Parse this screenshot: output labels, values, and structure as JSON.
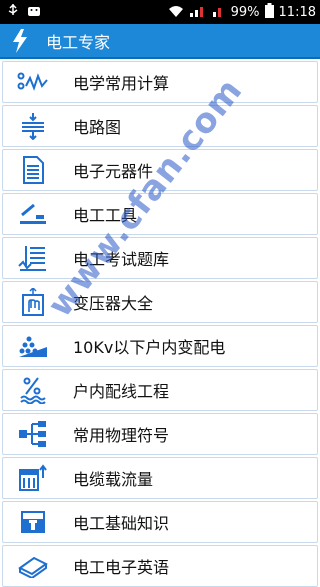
{
  "status": {
    "battery": "99%",
    "time": "11:18"
  },
  "appbar": {
    "title": "电工专家"
  },
  "menu": {
    "items": [
      {
        "label": "电学常用计算",
        "icon": "wave-formula-icon"
      },
      {
        "label": "电路图",
        "icon": "circuit-icon"
      },
      {
        "label": "电子元器件",
        "icon": "document-icon"
      },
      {
        "label": "电工工具",
        "icon": "tool-icon"
      },
      {
        "label": "电工考试题库",
        "icon": "exam-list-icon"
      },
      {
        "label": "变压器大全",
        "icon": "transformer-hand-icon"
      },
      {
        "label": "10Kv以下户内变配电",
        "icon": "substation-icon"
      },
      {
        "label": "户内配线工程",
        "icon": "percent-wiring-icon"
      },
      {
        "label": "常用物理符号",
        "icon": "symbol-tree-icon"
      },
      {
        "label": "电缆载流量",
        "icon": "cable-load-icon"
      },
      {
        "label": "电工基础知识",
        "icon": "basics-box-icon"
      },
      {
        "label": "电工电子英语",
        "icon": "english-book-icon"
      }
    ]
  },
  "watermark": {
    "text": "www.cfan.com"
  },
  "colors": {
    "appbar": "#1e88d8",
    "icon": "#1e6fd0",
    "border": "#c7d9ea"
  }
}
